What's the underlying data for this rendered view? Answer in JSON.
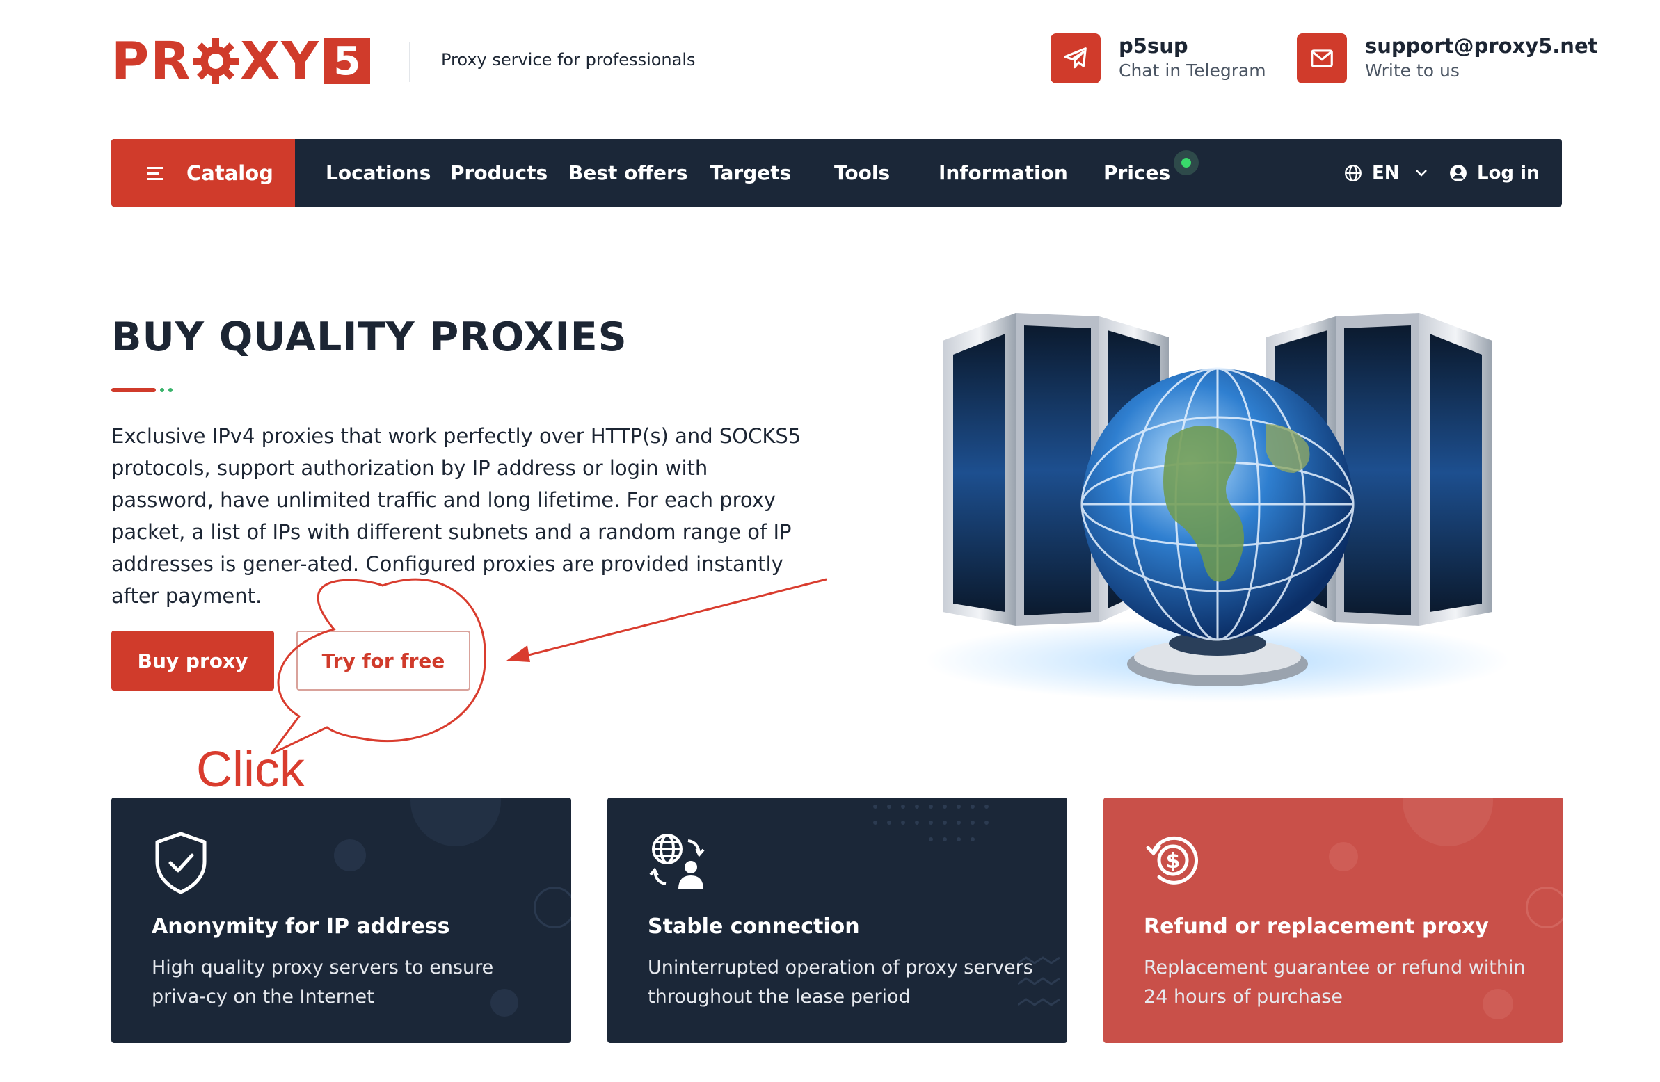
{
  "brand": {
    "logo_left": "PR",
    "logo_right": "XY",
    "logo_five": "5",
    "tagline": "Proxy service for professionals",
    "accent_color": "#d03b2b",
    "dark_color": "#1b2738"
  },
  "contacts": [
    {
      "title": "p5sup",
      "subtitle": "Chat in Telegram",
      "icon": "telegram-icon"
    },
    {
      "title": "support@proxy5.net",
      "subtitle": "Write to us",
      "icon": "mail-icon"
    }
  ],
  "nav": {
    "catalog": "Catalog",
    "items": [
      "Locations",
      "Products",
      "Best offers",
      "Targets",
      "Tools",
      "Information",
      "Prices"
    ],
    "language": "EN",
    "login": "Log in"
  },
  "hero": {
    "title": "BUY QUALITY PROXIES",
    "description": "Exclusive IPv4 proxies that work perfectly over HTTP(s) and SOCKS5 protocols, support authorization by IP address or login with password, have unlimited traffic and long lifetime. For each proxy packet, a list of IPs with different subnets and a random range of IP addresses is gener-ated. Configured proxies are provided instantly after payment.",
    "buy_button": "Buy proxy",
    "try_button": "Try for free",
    "image": "servers-globe-illustration"
  },
  "annotation": {
    "label": "Click",
    "color": "#d93c2e"
  },
  "features": [
    {
      "title": "Anonymity for IP address",
      "description": "High quality proxy servers to ensure priva-cy on the Internet",
      "icon": "shield-check-icon"
    },
    {
      "title": "Stable connection",
      "description": "Uninterrupted operation of proxy servers throughout the lease period",
      "icon": "globe-user-icon"
    },
    {
      "title": "Refund or replacement proxy",
      "description": "Replacement guarantee or refund within 24 hours of purchase",
      "icon": "refund-dollar-icon"
    }
  ]
}
